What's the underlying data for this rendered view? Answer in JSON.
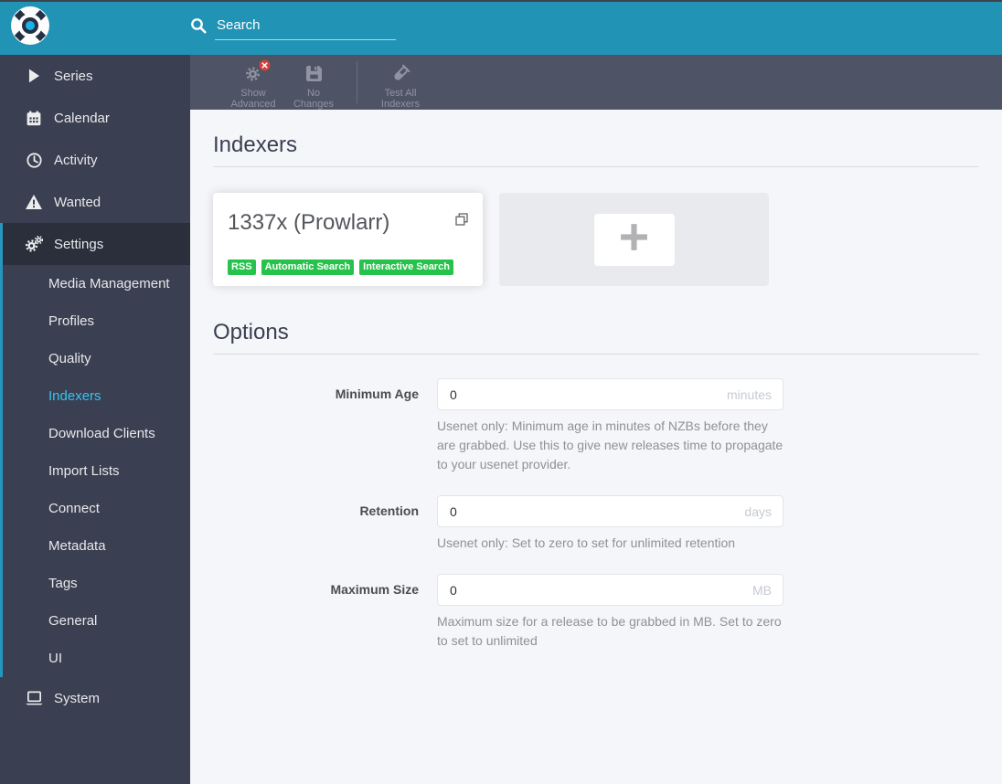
{
  "colors": {
    "header_bar": "#2193b5",
    "toolbar_bar": "#4e5366",
    "sidebar_bg": "#3a3f51",
    "sidebar_active_bg": "#2b2e3b",
    "accent_active": "#35c5f4",
    "badge_green": "#27c24c",
    "content_bg": "#f5f6f9"
  },
  "header": {
    "logo_icon": "sonarr-logo-icon",
    "search_placeholder": "Search"
  },
  "toolbar": {
    "buttons": [
      {
        "label": "Show Advanced",
        "icon": "gear-x-icon"
      },
      {
        "label": "No Changes",
        "icon": "floppy-save-icon"
      },
      {
        "label": "Test All Indexers",
        "icon": "vial-test-icon"
      }
    ]
  },
  "sidebar": {
    "items": [
      {
        "label": "Series",
        "icon": "play-icon"
      },
      {
        "label": "Calendar",
        "icon": "calendar-icon"
      },
      {
        "label": "Activity",
        "icon": "clock-icon"
      },
      {
        "label": "Wanted",
        "icon": "warning-triangle-icon"
      },
      {
        "label": "Settings",
        "icon": "gears-icon",
        "active": true
      },
      {
        "label": "System",
        "icon": "laptop-icon"
      }
    ],
    "settings_children": [
      {
        "label": "Media Management"
      },
      {
        "label": "Profiles"
      },
      {
        "label": "Quality"
      },
      {
        "label": "Indexers",
        "selected": true
      },
      {
        "label": "Download Clients"
      },
      {
        "label": "Import Lists"
      },
      {
        "label": "Connect"
      },
      {
        "label": "Metadata"
      },
      {
        "label": "Tags"
      },
      {
        "label": "General"
      },
      {
        "label": "UI"
      }
    ]
  },
  "content": {
    "indexers_section": {
      "title": "Indexers",
      "card": {
        "title": "1337x (Prowlarr)",
        "clone_icon": "copy-icon",
        "badges": [
          "RSS",
          "Automatic Search",
          "Interactive Search"
        ]
      },
      "add_card_icon": "plus-icon"
    },
    "options_section": {
      "title": "Options",
      "rows": [
        {
          "label": "Minimum Age",
          "value": "0",
          "unit": "minutes",
          "help": "Usenet only: Minimum age in minutes of NZBs before they are grabbed. Use this to give new releases time to propagate to your usenet provider."
        },
        {
          "label": "Retention",
          "value": "0",
          "unit": "days",
          "help": "Usenet only: Set to zero to set for unlimited retention"
        },
        {
          "label": "Maximum Size",
          "value": "0",
          "unit": "MB",
          "help": "Maximum size for a release to be grabbed in MB. Set to zero to set to unlimited"
        }
      ]
    }
  }
}
